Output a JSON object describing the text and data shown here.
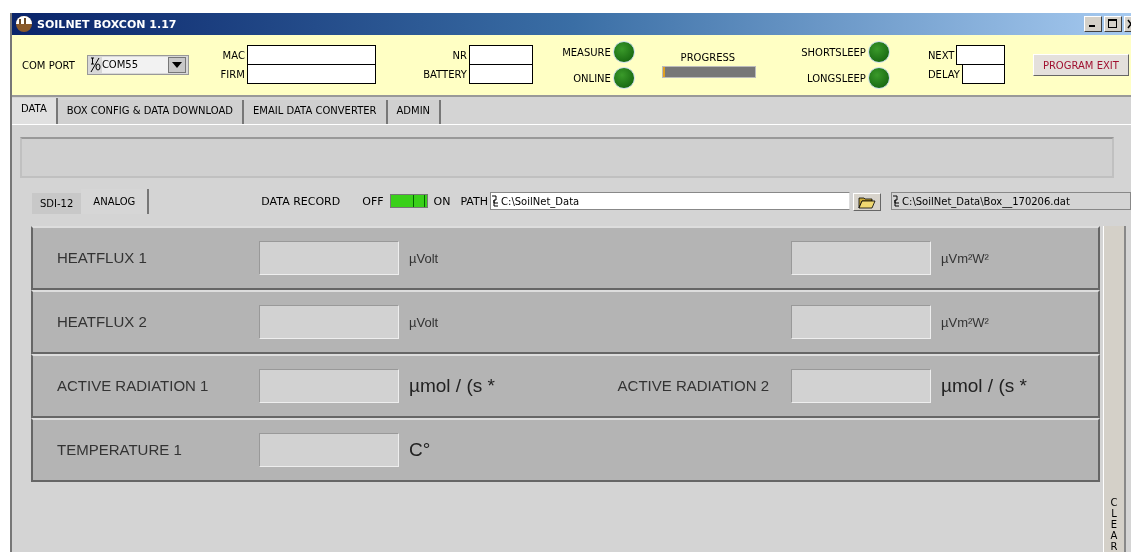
{
  "window": {
    "title": "SOILNET BOXCON 1.17"
  },
  "com_port": {
    "label": "COM PORT",
    "value": "COM55"
  },
  "id_fields": [
    {
      "label": "MAC"
    },
    {
      "label": "FIRM"
    }
  ],
  "box_fields": [
    {
      "label": "NR"
    },
    {
      "label": "BATTERY"
    }
  ],
  "state_leds": [
    {
      "label": "MEASURE",
      "on": false
    },
    {
      "label": "ONLINE",
      "on": false
    }
  ],
  "progress": {
    "label": "PROGRESS",
    "level": 0.02
  },
  "sleep_leds": [
    {
      "label": "SHORTSLEEP",
      "on": false
    },
    {
      "label": "LONGSLEEP",
      "on": false
    }
  ],
  "timing_fields": [
    {
      "label": "NEXT"
    },
    {
      "label": "DELAY"
    }
  ],
  "exit_button": {
    "label": "PROGRAM EXIT"
  },
  "tabs": [
    {
      "label": "DATA",
      "selected": true
    },
    {
      "label": "BOX CONFIG & DATA DOWNLOAD",
      "selected": false
    },
    {
      "label": "EMAIL DATA CONVERTER",
      "selected": false
    },
    {
      "label": "ADMIN",
      "selected": false
    }
  ],
  "subtabs": [
    {
      "label": "SDI-12",
      "selected": false
    },
    {
      "label": "ANALOG",
      "selected": true
    }
  ],
  "data_record": {
    "label": "DATA RECORD",
    "off_label": "OFF",
    "on_label": "ON",
    "on": true
  },
  "path": {
    "label": "PATH",
    "value": "C:\\SoilNet_Data"
  },
  "file": {
    "value": "C:\\SoilNet_Data\\Box__170206.dat"
  },
  "rows": [
    {
      "kind": "small",
      "items": [
        {
          "label": "HEATFLUX  1",
          "unit": "µVolt"
        },
        {
          "unit": "µVm²W²"
        }
      ]
    },
    {
      "kind": "small",
      "items": [
        {
          "label": "HEATFLUX  2",
          "unit": "µVolt"
        },
        {
          "unit": "µVm²W²"
        }
      ]
    },
    {
      "kind": "large",
      "items": [
        {
          "label": "ACTIVE RADIATION  1",
          "unit": "µmol / (s *"
        },
        {
          "label": "ACTIVE RADIATION  2",
          "unit": "µmol / (s *"
        }
      ]
    },
    {
      "kind": "large",
      "items": [
        {
          "label": "TEMPERATURE  1",
          "unit": "C°"
        }
      ]
    }
  ],
  "clear_button": {
    "label": "CLEAR"
  }
}
